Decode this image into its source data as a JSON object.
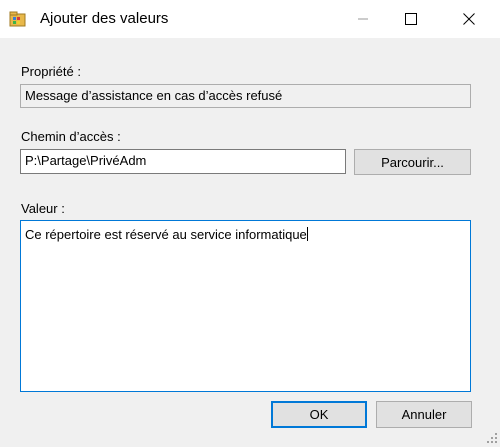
{
  "window": {
    "title": "Ajouter des valeurs",
    "icon": "registry-folder-icon"
  },
  "titlebar_buttons": {
    "minimize": "minimize-icon",
    "maximize": "maximize-icon",
    "close": "close-icon"
  },
  "property": {
    "label": "Propriété :",
    "value": "Message d’assistance en cas d’accès refusé"
  },
  "path": {
    "label": "Chemin d’accès :",
    "value": "P:\\Partage\\PrivéAdm",
    "browse_label": "Parcourir..."
  },
  "value": {
    "label": "Valeur :",
    "text": "Ce répertoire est réservé au service informatique"
  },
  "footer": {
    "ok_label": "OK",
    "cancel_label": "Annuler"
  },
  "colors": {
    "accent": "#0078d7",
    "background": "#f0f0f0"
  }
}
